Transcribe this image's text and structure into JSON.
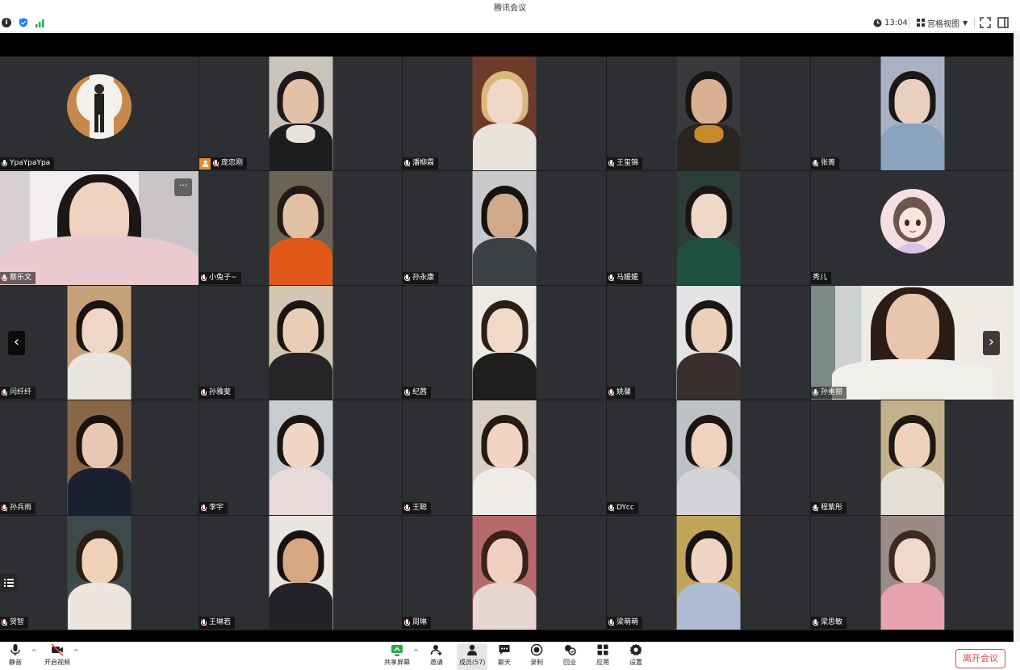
{
  "window": {
    "title": "腾讯会议"
  },
  "infobar": {
    "time": "13:04",
    "view_label": "宫格视图"
  },
  "participants": [
    {
      "name": "ҮраҮраҮра",
      "type": "avatar"
    },
    {
      "name": "庞忠刚",
      "host": true
    },
    {
      "name": "潘柳霖"
    },
    {
      "name": "王玺锦"
    },
    {
      "name": "张菁"
    },
    {
      "name": "蔡乐文",
      "type": "full"
    },
    {
      "name": "小兔子~"
    },
    {
      "name": "孙永康"
    },
    {
      "name": "马媛媛"
    },
    {
      "name": "秀儿",
      "type": "avatar2"
    },
    {
      "name": "闫纤纤"
    },
    {
      "name": "孙雅斐"
    },
    {
      "name": "纪茜"
    },
    {
      "name": "姚馨"
    },
    {
      "name": "孙重丽",
      "type": "full"
    },
    {
      "name": "孙兵雨"
    },
    {
      "name": "李宇"
    },
    {
      "name": "王聪"
    },
    {
      "name": "DYcc"
    },
    {
      "name": "程紫彤"
    },
    {
      "name": "贺智"
    },
    {
      "name": "王琳若"
    },
    {
      "name": "周琳"
    },
    {
      "name": "梁萌萌"
    },
    {
      "name": "梁思敏"
    }
  ],
  "toolbar": {
    "mute_label": "静音",
    "video_label": "开启视频",
    "share_label": "共享屏幕",
    "invite_label": "邀请",
    "members_label": "成员(57)",
    "chat_label": "聊天",
    "record_label": "录制",
    "homework_label": "回业",
    "apps_label": "应用",
    "settings_label": "设置",
    "leave_label": "离开会议"
  },
  "colors": {
    "leave": "#e84545",
    "host_badge": "#f08a24",
    "tile_bg": "#2d2f33"
  }
}
